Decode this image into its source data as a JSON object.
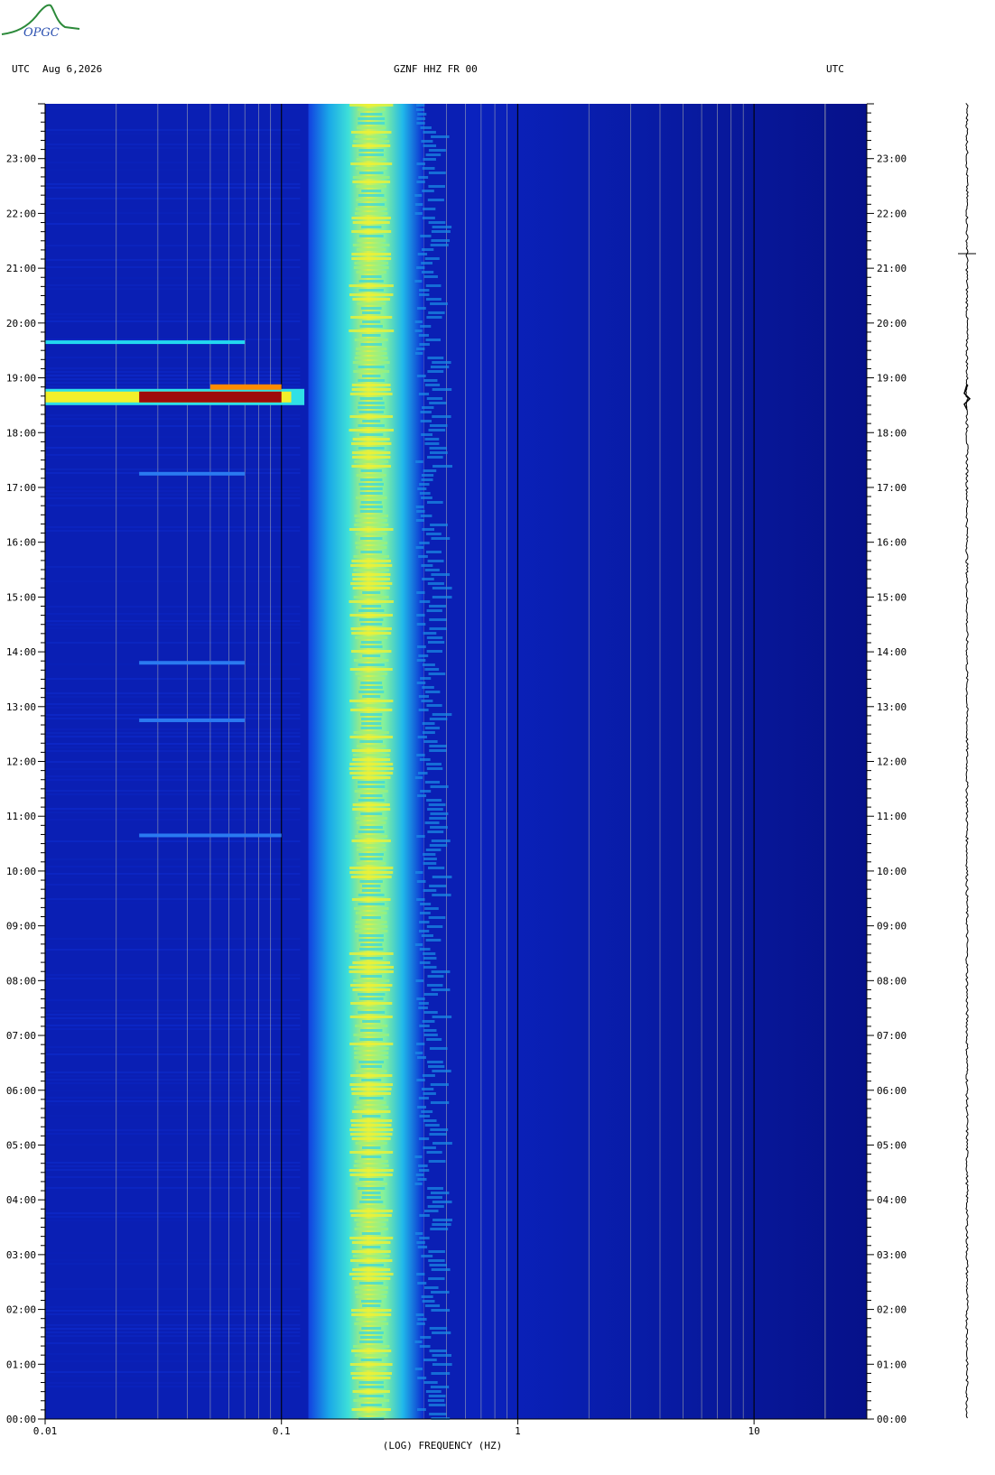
{
  "header": {
    "left_label": "UTC",
    "date": "Aug 6,2026",
    "station": "GZNF HHZ FR 00",
    "right_label": "UTC"
  },
  "logo": {
    "text": "OPGC"
  },
  "colors": {
    "background_blue": "#0a1fb4",
    "deep_blue": "#07108a",
    "band_cyan": "#18c9e6",
    "band_yellow": "#f2f02a",
    "event_red": "#9e0a0a",
    "event_orange": "#ff8a00",
    "gridline": "#d8d8b0",
    "decade_line": "#000000"
  },
  "chart_data": {
    "type": "heatmap",
    "title": "GZNF HHZ FR 00",
    "xlabel": "(LOG) FREQUENCY (HZ)",
    "ylabel": "UTC",
    "x_scale": "log",
    "xlim": [
      0.01,
      30
    ],
    "x_ticks": [
      {
        "value": 0.01,
        "label": "0.01"
      },
      {
        "value": 0.1,
        "label": "0.1"
      },
      {
        "value": 1,
        "label": "1"
      },
      {
        "value": 10,
        "label": "10"
      }
    ],
    "y_unit": "hour UTC",
    "ylim": [
      0,
      24
    ],
    "y_ticks": [
      "00:00",
      "01:00",
      "02:00",
      "03:00",
      "04:00",
      "05:00",
      "06:00",
      "07:00",
      "08:00",
      "09:00",
      "10:00",
      "11:00",
      "12:00",
      "13:00",
      "14:00",
      "15:00",
      "16:00",
      "17:00",
      "18:00",
      "19:00",
      "20:00",
      "21:00",
      "22:00",
      "23:00"
    ],
    "microseism_band": {
      "freq_low_hz": 0.13,
      "freq_peak_hz": 0.24,
      "freq_high_hz": 0.4,
      "description_colors": [
        "cyan",
        "yellow"
      ]
    },
    "events": [
      {
        "time_utc_hours": 18.65,
        "freq_low_hz": 0.01,
        "freq_high_hz": 0.1,
        "intensity": "max"
      },
      {
        "time_utc_hours": 19.65,
        "freq_low_hz": 0.01,
        "freq_high_hz": 0.07,
        "intensity": "medium"
      },
      {
        "time_utc_hours": 17.25,
        "freq_low_hz": 0.025,
        "freq_high_hz": 0.07,
        "intensity": "low"
      },
      {
        "time_utc_hours": 13.8,
        "freq_low_hz": 0.025,
        "freq_high_hz": 0.07,
        "intensity": "low"
      },
      {
        "time_utc_hours": 12.75,
        "freq_low_hz": 0.025,
        "freq_high_hz": 0.07,
        "intensity": "low"
      },
      {
        "time_utc_hours": 10.65,
        "freq_low_hz": 0.025,
        "freq_high_hz": 0.1,
        "intensity": "low"
      }
    ]
  }
}
